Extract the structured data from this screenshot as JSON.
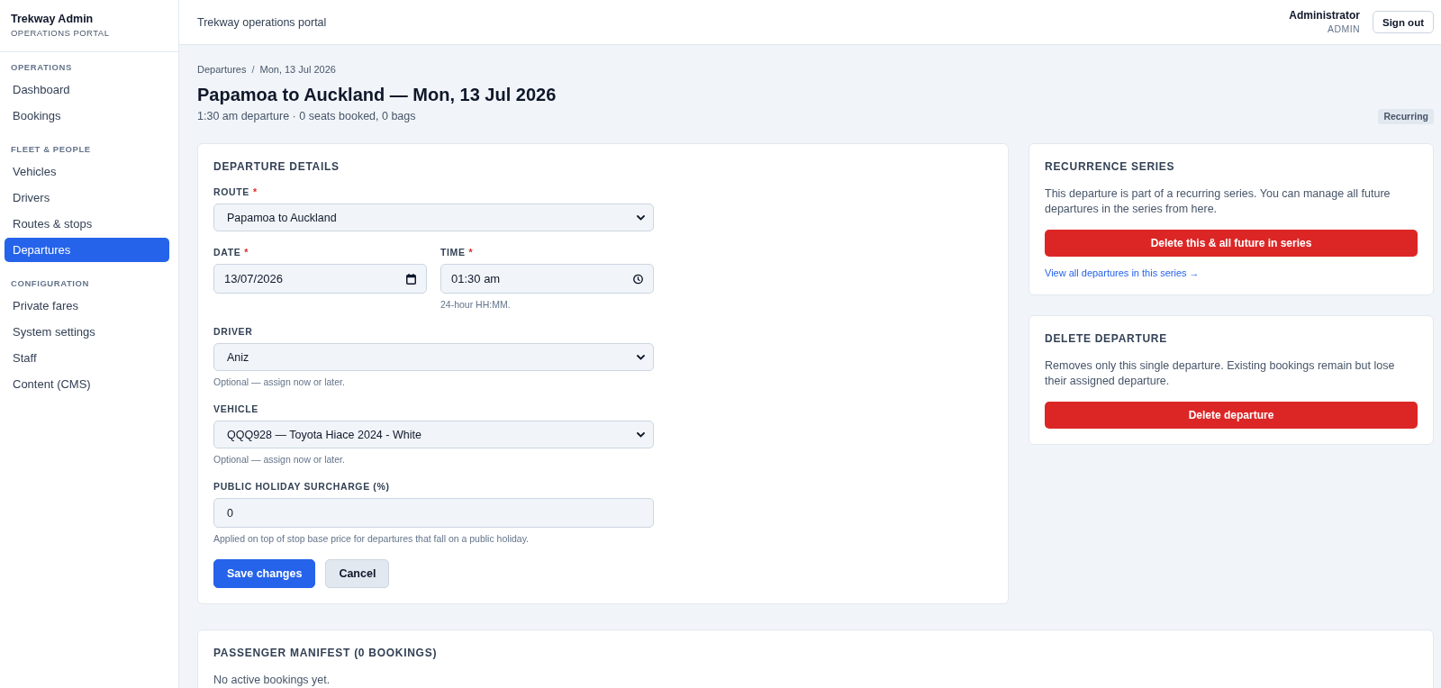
{
  "sidebar": {
    "brand": {
      "title": "Trekway Admin",
      "subtitle": "OPERATIONS PORTAL"
    },
    "sections": [
      {
        "heading": "OPERATIONS",
        "items": [
          {
            "label": "Dashboard",
            "selected": false
          },
          {
            "label": "Bookings",
            "selected": false
          }
        ]
      },
      {
        "heading": "FLEET & PEOPLE",
        "items": [
          {
            "label": "Vehicles",
            "selected": false
          },
          {
            "label": "Drivers",
            "selected": false
          },
          {
            "label": "Routes & stops",
            "selected": false
          },
          {
            "label": "Departures",
            "selected": true
          }
        ]
      },
      {
        "heading": "CONFIGURATION",
        "items": [
          {
            "label": "Private fares",
            "selected": false
          },
          {
            "label": "System settings",
            "selected": false
          },
          {
            "label": "Staff",
            "selected": false
          },
          {
            "label": "Content (CMS)",
            "selected": false
          }
        ]
      }
    ]
  },
  "topbar": {
    "title": "Trekway operations portal",
    "user": {
      "name": "Administrator",
      "role": "ADMIN"
    },
    "sign_out": "Sign out"
  },
  "header": {
    "breadcrumb": {
      "items": [
        "Departures",
        "Mon, 13 Jul 2026"
      ],
      "separator": "/"
    },
    "title": "Papamoa to Auckland — Mon, 13 Jul 2026",
    "subtitle": "1:30 am departure · 0 seats booked, 0 bags",
    "badge": "Recurring"
  },
  "details_card": {
    "heading": "DEPARTURE DETAILS",
    "field_rows": [
      [
        {
          "kind": "select",
          "label": "ROUTE",
          "required_mark": "*",
          "value": "Papamoa to Auckland"
        }
      ],
      [
        {
          "kind": "date",
          "label": "DATE",
          "required_mark": "*",
          "value": "13/07/2026"
        },
        {
          "kind": "time",
          "label": "TIME",
          "required_mark": "*",
          "value": "01:30 am",
          "hint": "24-hour HH:MM."
        }
      ],
      [
        {
          "kind": "select",
          "label": "DRIVER",
          "value": "Aniz",
          "hint": "Optional — assign now or later."
        }
      ],
      [
        {
          "kind": "select",
          "label": "VEHICLE",
          "value": "QQQ928 — Toyota Hiace 2024 - White",
          "hint": "Optional — assign now or later."
        }
      ],
      [
        {
          "kind": "number",
          "label": "PUBLIC HOLIDAY SURCHARGE (%)",
          "value": "0",
          "hint": "Applied on top of stop base price for departures that fall on a public holiday."
        }
      ]
    ],
    "actions": [
      {
        "kind": "primary",
        "label": "Save changes"
      },
      {
        "kind": "secondary",
        "label": "Cancel"
      }
    ]
  },
  "side_cards": [
    {
      "heading": "RECURRENCE SERIES",
      "text": "This departure is part of a recurring series. You can manage all future departures in the series from here.",
      "button": "Delete this & all future in series",
      "link": "View all departures in this series →"
    },
    {
      "heading": "DELETE DEPARTURE",
      "text": "Removes only this single departure. Existing bookings remain but lose their assigned departure.",
      "button": "Delete departure"
    }
  ],
  "manifest": {
    "heading": "PASSENGER MANIFEST (0 BOOKINGS)",
    "empty_text": "No active bookings yet."
  }
}
